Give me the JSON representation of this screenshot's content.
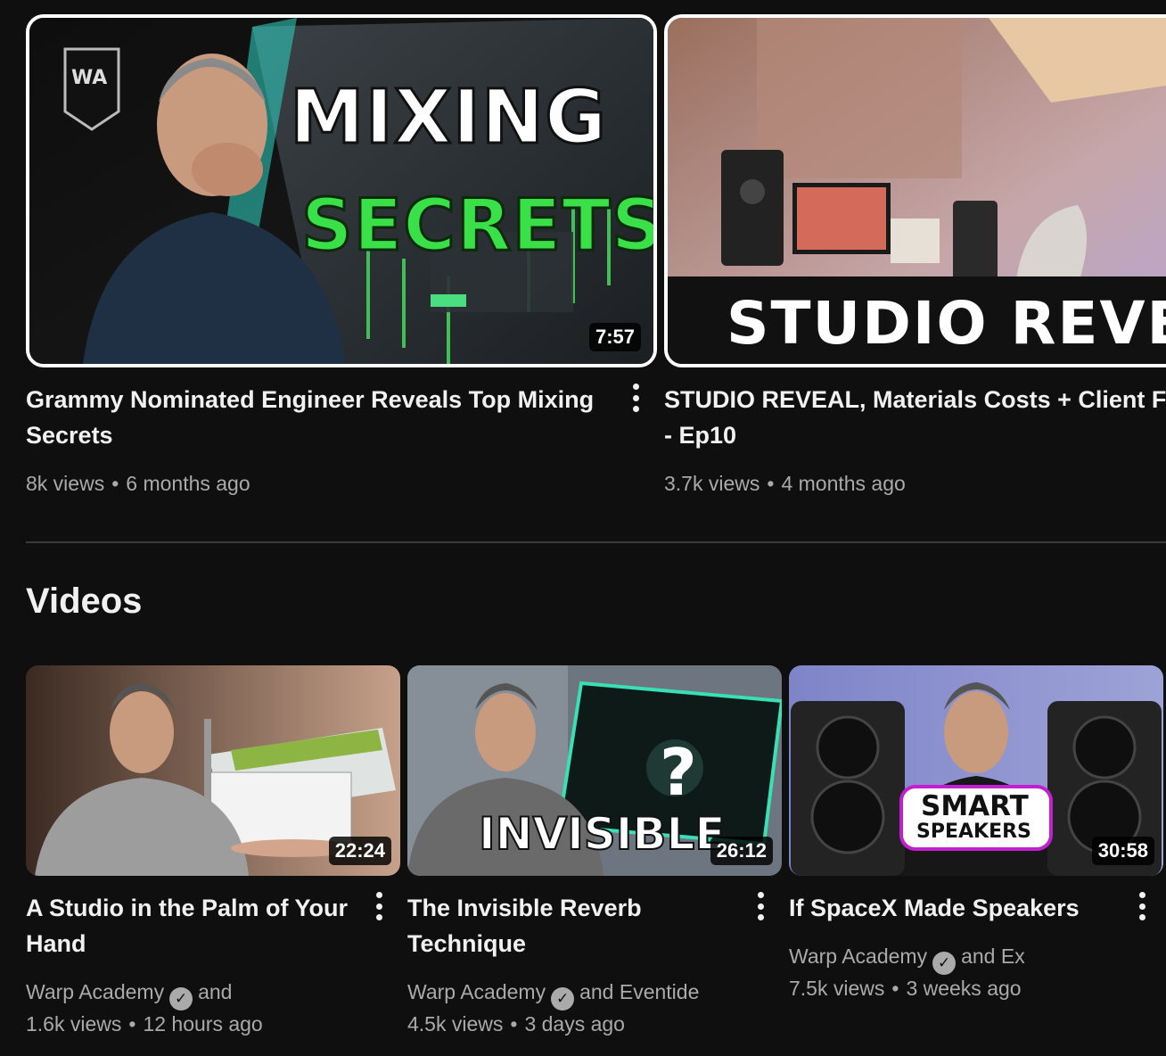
{
  "shelf": [
    {
      "thumb_line1": "MIXING",
      "thumb_line2": "SECRETS",
      "duration": "7:57",
      "title_line1": "Grammy Nominated Engineer Reveals Top Mixing",
      "title_line2": "Secrets",
      "views": "8k views",
      "age": "6 months ago"
    },
    {
      "thumb_text": "STUDIO REVEA",
      "title_line1": "STUDIO REVEAL, Materials Costs + Client Fee",
      "title_line2": "- Ep10",
      "views": "3.7k views",
      "age": "4 months ago"
    }
  ],
  "section_title": "Videos",
  "videos": [
    {
      "duration": "22:24",
      "title_line1": "A Studio in the Palm of Your",
      "title_line2": "Hand",
      "channel": "Warp Academy",
      "collab": "and",
      "views": "1.6k views",
      "age": "12 hours ago"
    },
    {
      "thumb_text": "INVISIBLE",
      "thumb_mark": "?",
      "duration": "26:12",
      "title_line1": "The Invisible Reverb",
      "title_line2": "Technique",
      "channel": "Warp Academy",
      "collab": "and Eventide",
      "views": "4.5k views",
      "age": "3 days ago"
    },
    {
      "thumb_line1": "SMART",
      "thumb_line2": "SPEAKERS",
      "duration": "30:58",
      "title_line1": "If SpaceX Made Speakers",
      "channel": "Warp Academy",
      "collab": "and Ex",
      "views": "7.5k views",
      "age": "3 weeks ago"
    }
  ],
  "dot": "•",
  "logo_text": "WA",
  "check_glyph": "✓"
}
